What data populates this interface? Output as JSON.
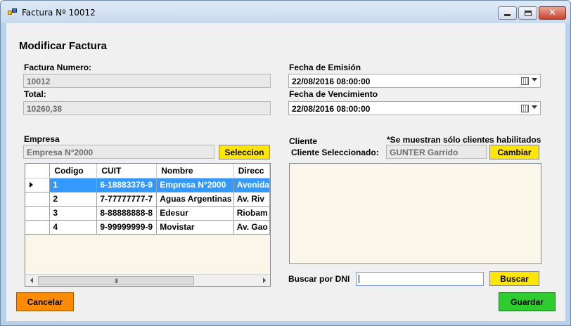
{
  "window": {
    "title": "Factura Nº 10012",
    "icon": "app-icon",
    "controls": {
      "minimize": "minimize-icon",
      "maximize": "maximize-icon",
      "close": "✕"
    }
  },
  "form": {
    "heading": "Modificar Factura",
    "factura_numero_label": "Factura Numero:",
    "factura_numero_value": "10012",
    "total_label": "Total:",
    "total_value": "10260,38",
    "fecha_emision_label": "Fecha de Emisión",
    "fecha_emision_value": "22/08/2016 08:00:00",
    "fecha_vencimiento_label": "Fecha de Vencimiento",
    "fecha_vencimiento_value": "22/08/2016 08:00:00"
  },
  "empresa": {
    "label": "Empresa",
    "selected_value": "Empresa N°2000",
    "select_button": "Seleccion",
    "grid": {
      "columns": [
        "Codigo",
        "CUIT",
        "Nombre",
        "Direcc"
      ],
      "rows": [
        [
          "1",
          "6-18883376-9",
          "Empresa N°2000",
          "Avenida"
        ],
        [
          "2",
          "7-77777777-7",
          "Aguas Argentinas",
          "Av. Riv"
        ],
        [
          "3",
          "8-88888888-8",
          "Edesur",
          "Riobam"
        ],
        [
          "4",
          "9-99999999-9",
          "Movistar",
          "Av. Gao"
        ]
      ],
      "selected_row": 0,
      "scroll_thumb": "III"
    }
  },
  "cliente": {
    "label": "Cliente",
    "note": "*Se muestran sólo clientes habilitados",
    "selected_label": "Cliente Seleccionado:",
    "selected_value": "GUNTER Garrido",
    "change_button": "Cambiar",
    "search_label": "Buscar por DNI",
    "search_value": "",
    "search_button": "Buscar"
  },
  "footer": {
    "cancel_button": "Cancelar",
    "save_button": "Guardar"
  },
  "colors": {
    "yellow_button": "#ffe600",
    "cancel_button": "#ff8c00",
    "save_button": "#2ecc2e",
    "selected_row": "#3399ff",
    "panel_background": "#fbf6ea"
  }
}
